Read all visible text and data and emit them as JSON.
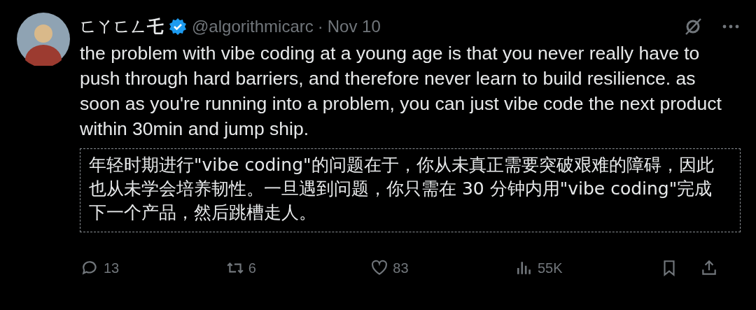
{
  "author": {
    "display_name": "ㄈㄚㄈㄥ乇",
    "verified": true,
    "handle": "@algorithmicarc",
    "separator": "·",
    "date": "Nov 10"
  },
  "text": "the problem with vibe coding at a young age is that you never really have to push through hard barriers, and therefore never learn to build resilience. as soon as you're running into a problem, you can just vibe code the next product within 30min and jump ship.",
  "translation": "年轻时期进行\"vibe coding\"的问题在于，你从未真正需要突破艰难的障碍，因此也从未学会培养韧性。一旦遇到问题，你只需在 30 分钟内用\"vibe coding\"完成下一个产品，然后跳槽走人。",
  "actions": [
    {
      "kind": "reply",
      "count": "13"
    },
    {
      "kind": "repost",
      "count": "6"
    },
    {
      "kind": "like",
      "count": "83"
    },
    {
      "kind": "views",
      "count": "55K"
    },
    {
      "kind": "bookmark"
    },
    {
      "kind": "share"
    }
  ]
}
